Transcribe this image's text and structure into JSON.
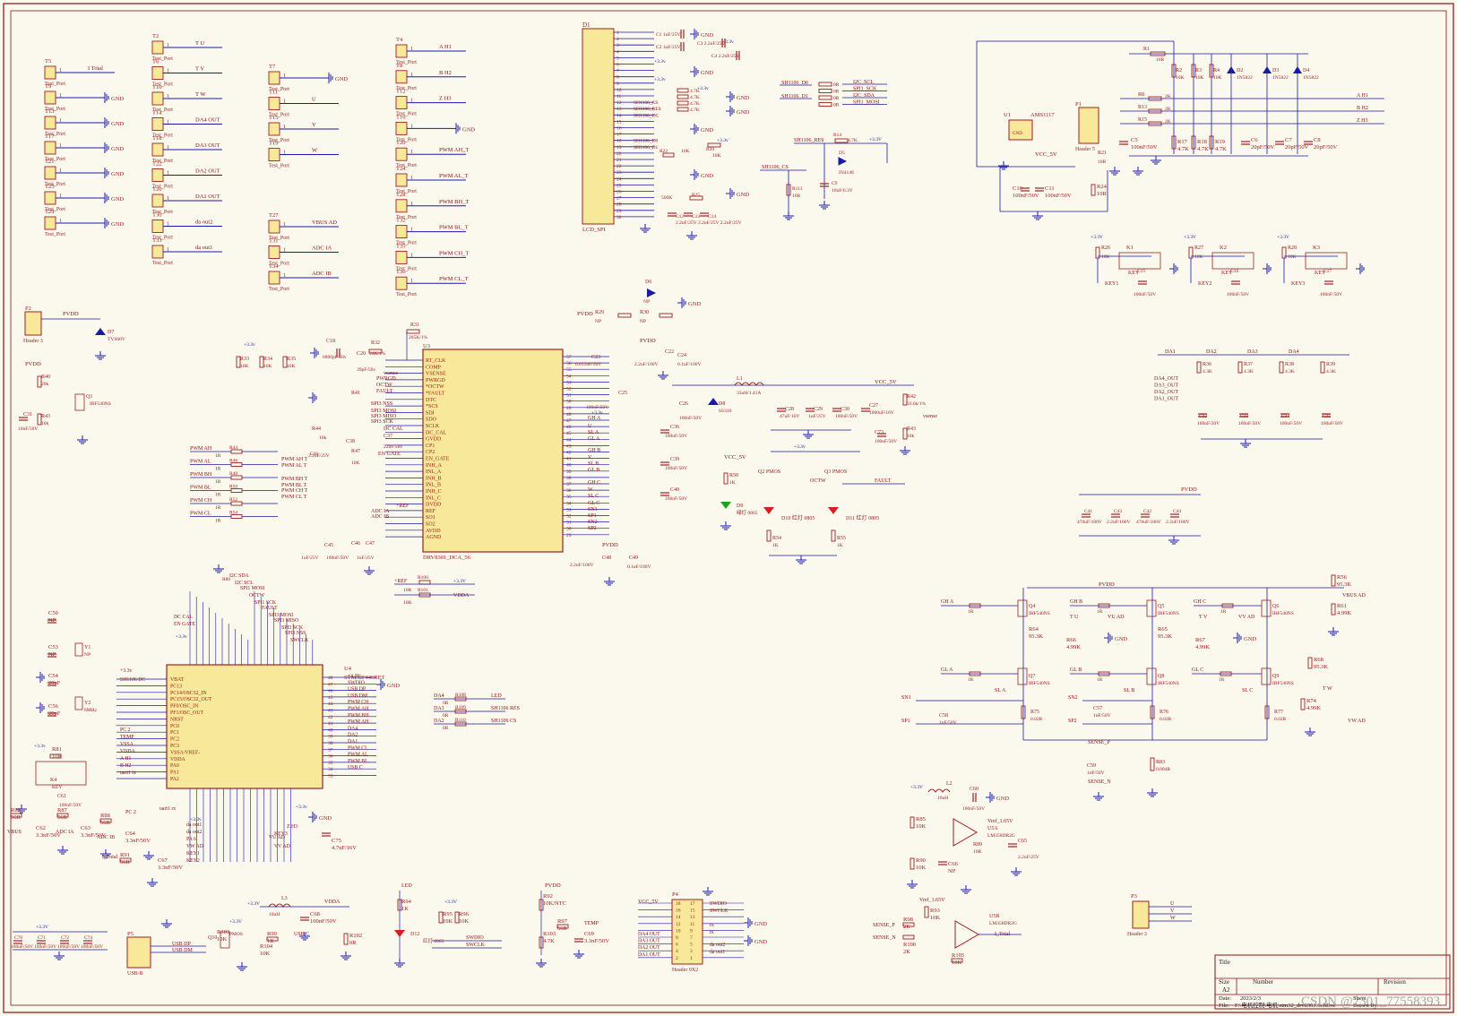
{
  "colors": {
    "paper": "#fbf8ee",
    "wire": "#1a1aa8",
    "part": "#a02020",
    "body": "#f8e89a",
    "netlabel": "#8a1010",
    "power": "#1a1aa8"
  },
  "test_ports": [
    {
      "ref": "T5",
      "net": "I_Total",
      "pin": "1",
      "sub": "Test_Port"
    },
    {
      "ref": "T9",
      "net": "GND",
      "pin": "1",
      "sub": "Test_Port"
    },
    {
      "ref": "T13",
      "net": "GND",
      "pin": "1",
      "sub": "Test_Port"
    },
    {
      "ref": "T17",
      "net": "GND",
      "pin": "1",
      "sub": "Test_Port"
    },
    {
      "ref": "T21",
      "net": "GND",
      "pin": "1",
      "sub": "Test_Port"
    },
    {
      "ref": "T25",
      "net": "GND",
      "pin": "1",
      "sub": "Test_Port"
    },
    {
      "ref": "T29",
      "net": "GND",
      "pin": "1",
      "sub": "Test_Port"
    },
    {
      "ref": "T2",
      "net": "T_U",
      "pin": "1",
      "sub": "Test_Port"
    },
    {
      "ref": "T6",
      "net": "T_V",
      "pin": "1",
      "sub": "Test_Port"
    },
    {
      "ref": "T10",
      "net": "T_W",
      "pin": "1",
      "sub": "Test_Port"
    },
    {
      "ref": "T14",
      "net": "DA4_OUT",
      "pin": "1",
      "sub": "Test_Port"
    },
    {
      "ref": "T18",
      "net": "DA3_OUT",
      "pin": "1",
      "sub": "Test_Port"
    },
    {
      "ref": "T22",
      "net": "DA2_OUT",
      "pin": "1",
      "sub": "Test_Port"
    },
    {
      "ref": "T26",
      "net": "DA1_OUT",
      "pin": "1",
      "sub": "Test_Port"
    },
    {
      "ref": "T30",
      "net": "da_out2",
      "pin": "1",
      "sub": "Test_Port"
    },
    {
      "ref": "T33",
      "net": "da_out1",
      "pin": "1",
      "sub": "Test_Port"
    },
    {
      "ref": "T7",
      "net": "GND",
      "pin": "1",
      "sub": "Test_Port"
    },
    {
      "ref": "T11",
      "net": "U",
      "pin": "1",
      "sub": "Test_Port"
    },
    {
      "ref": "T15",
      "net": "V",
      "pin": "1",
      "sub": "Test_Port"
    },
    {
      "ref": "T19",
      "net": "W",
      "pin": "1",
      "sub": "Test_Port"
    },
    {
      "ref": "T27",
      "net": "VBUS_AD",
      "pin": "1",
      "sub": "Test_Port"
    },
    {
      "ref": "T31",
      "net": "ADC_IA",
      "pin": "1",
      "sub": "Test_Port"
    },
    {
      "ref": "T34",
      "net": "ADC_IB",
      "pin": "1",
      "sub": "Test_Port"
    },
    {
      "ref": "T4",
      "net": "A_H1",
      "pin": "1",
      "sub": "Test_Port"
    },
    {
      "ref": "T8",
      "net": "B_H2",
      "pin": "1",
      "sub": "Test_Port"
    },
    {
      "ref": "T12",
      "net": "Z_H3",
      "pin": "1",
      "sub": "Test_Port"
    },
    {
      "ref": "T16",
      "net": "GND",
      "pin": "1",
      "sub": "Test_Port"
    },
    {
      "ref": "T20",
      "net": "PWM_AH_T",
      "pin": "1",
      "sub": "Test_Port"
    },
    {
      "ref": "T24",
      "net": "PWM_AL_T",
      "pin": "1",
      "sub": "Test_Port"
    },
    {
      "ref": "T28",
      "net": "PWM_BH_T",
      "pin": "1",
      "sub": "Test_Port"
    },
    {
      "ref": "T32",
      "net": "PWM_BL_T",
      "pin": "1",
      "sub": "Test_Port"
    },
    {
      "ref": "T35",
      "net": "PWM_CH_T",
      "pin": "1",
      "sub": "Test_Port"
    },
    {
      "ref": "T36",
      "net": "PWM_CL_T",
      "pin": "1",
      "sub": "Test_Port"
    }
  ],
  "lcd": {
    "ref": "D1",
    "value": "LCD_SPI",
    "pins": [
      "1",
      "2",
      "3",
      "4",
      "5",
      "6",
      "7",
      "8",
      "9",
      "10",
      "11",
      "12",
      "13",
      "14",
      "15",
      "16",
      "17",
      "18",
      "19",
      "20",
      "21",
      "22",
      "23",
      "24",
      "25",
      "26",
      "27",
      "28",
      "29",
      "30"
    ],
    "nets": [
      {
        "pin": "12",
        "name": "SH1106_CS"
      },
      {
        "pin": "13",
        "name": "SH1106_RES"
      },
      {
        "pin": "14",
        "name": "SH1106_DC"
      },
      {
        "pin": "18",
        "name": "SH1106_D0"
      },
      {
        "pin": "19",
        "name": "SH1106_D1"
      }
    ],
    "parts": [
      "C1 1uF/25V",
      "C2 1uF/25V",
      "C3 2.2uF/25V",
      "C4 2.2uF/25V",
      "R5 4.7K",
      "R6 4.7K",
      "R7 4.7K",
      "R8 4.7K",
      "R20 10K",
      "R22 0R",
      "R23 10K",
      "R25 560K",
      "C12 2.2uF/25V",
      "C13 2.2uF/25V",
      "C14 2.2uF/25V"
    ]
  },
  "i2c_block": {
    "rows": [
      {
        "left": "SH1106_D0",
        "res": "0R",
        "right": "I2C_SCL"
      },
      {
        "left": "",
        "res": "0R",
        "right": "SPI1_SCK"
      },
      {
        "left": "SH1106_D1",
        "res": "0R",
        "right": "I2C_SDA"
      },
      {
        "left": "",
        "res": "0R",
        "right": "SPI1_MOSI"
      }
    ],
    "res_refs": [
      "R9",
      "R10",
      "R11",
      "R12"
    ]
  },
  "reset_block": {
    "net": "SH1106_RES",
    "r": "R14 4.7K",
    "supply": "+3.3V",
    "diode": "D5 IN4148",
    "cap": "C9 10uF/6.3V"
  },
  "cs_block": {
    "net": "SH1106_CS",
    "r": "R111 10R"
  },
  "hall_block": {
    "u": "U1",
    "reg": "AMS1117",
    "vcc": "VCC_5V",
    "header": "P1",
    "header_value": "Header 5",
    "outputs": [
      "A_H1",
      "B_H2",
      "Z_H3"
    ],
    "parts": [
      "R1 10R",
      "R2 10K",
      "R3 10K",
      "R4 10K",
      "D2 1N5822",
      "D3 1N5822",
      "D4 1N5822",
      "R8 2K",
      "R13 2K",
      "R15 2K",
      "R17 4.7K",
      "R18 4.7K",
      "R19 4.7K",
      "C6 20pF/50V",
      "C7 20pF/50V",
      "C8 20pF/50V",
      "C5 100nF/50V",
      "R21 10R",
      "R24 10R",
      "C10 100nF/50V",
      "C11 100nF/50V"
    ]
  },
  "keys": [
    {
      "ref": "K1",
      "r": "R26 10K",
      "net": "KEY1",
      "cap": "C15 100nF/50V",
      "supply": "+3.3V"
    },
    {
      "ref": "K2",
      "r": "R27 10K",
      "net": "KEY2",
      "cap": "C16 100nF/50V",
      "supply": "+3.3V"
    },
    {
      "ref": "K3",
      "r": "R28 10K",
      "net": "KEY3",
      "cap": "C17 100nF/50V",
      "supply": "+3.3V"
    }
  ],
  "drv": {
    "ref": "U3",
    "value": "DRV8301_DCA_56",
    "left_pins": [
      "RT_CLK",
      "COMP",
      "VSENSE",
      "PWRGD",
      "*OCTW",
      "*FAULT",
      "DTC",
      "*SCS",
      "SDI",
      "SDO",
      "SCLK",
      "DC_CAL",
      "GVDD",
      "CP1",
      "CP2",
      "EN_GATE",
      "INH_A",
      "INL_A",
      "INH_B",
      "INL_B",
      "INH_C",
      "INL_C",
      "DVDD",
      "REF",
      "SO1",
      "SO2",
      "AVDD",
      "AGND"
    ],
    "right_pins": [
      "57",
      "56",
      "55",
      "54",
      "53",
      "52",
      "51",
      "50",
      "49",
      "48",
      "47",
      "46",
      "45",
      "44",
      "43",
      "42",
      "41",
      "40",
      "39",
      "38",
      "37",
      "36",
      "35",
      "34",
      "33",
      "32",
      "31",
      "30",
      "29"
    ],
    "left_nets": [
      "vsense",
      "PWRGD",
      "OCTW",
      "FAULT",
      "SPI3_NSS",
      "SPI3_MOSI",
      "SPI3_MISO",
      "SPI3_SCK",
      "DC_CAL",
      "EN_GATE",
      "PWM_AH_T",
      "PWM_AL_T",
      "PWM_BH_T",
      "PWM_BL_T",
      "PWM_CH_T",
      "PWM_CL_T",
      "+REF",
      "ADC_IA",
      "ADC_IB"
    ],
    "right_nets": [
      "GH_A",
      "U",
      "SL_A",
      "GL_A",
      "GH_B",
      "V",
      "SL_B",
      "GL_B",
      "GH_C",
      "W",
      "SL_C",
      "GL_C",
      "SN1",
      "SP1",
      "SN2",
      "SP2"
    ],
    "pwm_in": [
      "PWM_AH",
      "PWM_AL",
      "PWM_BH",
      "PWM_BL",
      "PWM_CH",
      "PWM_CL"
    ]
  },
  "buck": {
    "l1": "L1 33uH/1.41A",
    "d8": "D8 SS310",
    "vout": "VCC_5V",
    "r42": "R42 33.6k/1%",
    "r43": "R43 10k",
    "c27": "C27 1000uF/16V",
    "c28": "C28 47uF/16V",
    "c29": "C29 1uF/25V",
    "c30": "C30 100nF/50V",
    "c73": "C73 100nF/50V",
    "net": "vsense"
  },
  "mosfet_leds": {
    "q2": "Q2 PMOS",
    "q3": "Q3 PMOS",
    "d10": "D10 红灯 0805",
    "d11": "D11 红灯 0805",
    "d9": "D9 绿灯 0805",
    "r50": "R50 1K",
    "r54": "R54 1K",
    "r55": "R55 1K",
    "net1": "OCTW",
    "net2": "FAULT",
    "supply": "+3.3v",
    "vcc": "VCC_5V"
  },
  "header3": {
    "ref": "P2",
    "value": "Header 3",
    "pvdd": "PVDD",
    "d7": "D7 TVS60V",
    "q1": "Q1 IRF540NS",
    "r40": "R40 20k",
    "r43": "R43 10k",
    "c31": "C31 10nF/50V"
  },
  "dac_block": {
    "nets": [
      "DA1",
      "DA2",
      "DA3",
      "DA4"
    ],
    "outs": [
      "DA4_OUT",
      "DA3_OUT",
      "DA2_OUT",
      "DA1_OUT"
    ],
    "res": [
      "R36 4.3K",
      "R37 4.3K",
      "R38 4.3K",
      "R39 4.3K"
    ],
    "caps": [
      "C32 100nF/50V",
      "C33 100nF/50V",
      "C34 100nF/50V",
      "C35 100nF/50V"
    ]
  },
  "bulk_caps": {
    "net": "PVDD",
    "caps": [
      "C41 470uF/100V",
      "C43 2.2uF/100V",
      "C42 470uF/100V",
      "C44 2.2uF/100V"
    ]
  },
  "bridge": {
    "net": "PVDD",
    "gates": [
      "GH_A",
      "GL_A",
      "GH_B",
      "GL_B",
      "GH_C",
      "GL_C"
    ],
    "fets": [
      "Q4 IRF540NS",
      "Q7 IRF540NS",
      "Q5 IRF540NS",
      "Q8 IRF540NS",
      "Q6 IRF540NS",
      "Q9 IRF540NS"
    ],
    "sense": [
      "SN1",
      "SP1",
      "SN2",
      "SP2",
      "SL_A",
      "SL_B",
      "SL_C"
    ],
    "outs": [
      "VBUS_AD",
      "VU_AD",
      "VV_AD",
      "VW_AD",
      "T_U",
      "T_V",
      "T_W",
      "SENSE_P",
      "SENSE_N"
    ],
    "parts": [
      "R56 95.3K",
      "R61 4.99K",
      "R64 95.3K",
      "R66 4.99K",
      "R65 95.3K",
      "R67 4.99K",
      "R68 95.3K",
      "R74 4.99K",
      "R75 0.02R",
      "R76 0.02R",
      "R77 0.02R",
      "R83 0.004R",
      "C57 1nF/50V",
      "C58 1nF/50V",
      "C59 1nF/50V"
    ]
  },
  "amp": {
    "u": "U5A",
    "value": "LM358DR2G",
    "vref": "Vref_1.65V",
    "l2": "L2 10uH",
    "c60": "C60 100nF/50V",
    "r85": "R85 10K",
    "r86": "R86 10K",
    "r90": "R90 10K",
    "c65": "C65 2.2uF/25V",
    "c66": "C66 NP",
    "supply": "+3.3V"
  },
  "amp2": {
    "u": "U5B",
    "value": "LM358DR2G",
    "vref": "Vref_1.65V",
    "r93": "R93 10K",
    "r98": "R98 2K",
    "r100": "R100 2K",
    "r105": "R105 10K",
    "inputs": [
      "SENSE_P",
      "SENSE_N"
    ],
    "out": "I_Total"
  },
  "p3": {
    "ref": "P3",
    "value": "Header 3",
    "pins": [
      "U",
      "V",
      "W"
    ]
  },
  "mcu": {
    "ref": "U4",
    "value": "STM32F446RET",
    "left_pins": [
      "VBAT",
      "PC13",
      "PC14/OSC32_IN",
      "PC15/OSC32_OUT",
      "PF0/OSC_IN",
      "PF1/OSC_OUT",
      "NRST",
      "PC0",
      "PC1",
      "PC2",
      "PC3",
      "VSSA/VREF-",
      "VDDA",
      "PA0",
      "PA1",
      "PA2"
    ],
    "right_nums": [
      "48",
      "47",
      "46",
      "45",
      "44",
      "43",
      "42",
      "41",
      "40",
      "39",
      "38",
      "37",
      "36",
      "35",
      "34",
      "33"
    ],
    "right_nets": [
      "+3.3V",
      "SWDIO",
      "USB_DP",
      "USB_DM",
      "PWM_CH",
      "PWM_AH",
      "PWM_BH",
      "PWM_AH",
      "DA4",
      "DA2",
      "DA1",
      "PWM_CL",
      "PWM_AL",
      "PWM_BL",
      "USB_C"
    ],
    "left_nets": [
      "+3.3v",
      "SH1106_DC",
      "PC_2",
      "TEMP",
      "VSSA",
      "VDDA",
      "A_H1",
      "B_H2",
      "uart1_tx"
    ],
    "top_nets": [
      "I2C_SDA",
      "I2C_SCL",
      "SPI1_MOSI",
      "OCTW",
      "SPI1_SCK",
      "FAULT",
      "SPI3_MOSI",
      "SPI3_MISO",
      "SPI3_SCK",
      "SPI3_NSS",
      "SWCLK",
      "DC_CAL",
      "EN_GATE"
    ],
    "bottom_nets": [
      "uart1_rx",
      "da_out1",
      "da_out2",
      "PA_6",
      "VW_AD",
      "KEY1",
      "KEY2",
      "Z_H3",
      "VU_AD",
      "KEY3",
      "VV_AD"
    ],
    "parts": [
      "C50 NP",
      "C53 NP",
      "Y1 NP",
      "C54 20pF",
      "C56 20pF",
      "Y2 8MHz",
      "R81 10K",
      "K4 KEY",
      "C61 100nF/50V",
      "R86 56R",
      "R87 56R",
      "R88 56R",
      "C62 3.3nF/50V",
      "C63 3.3nF/50V",
      "C64 3.3nF/50V",
      "R91 56R",
      "C67 3.3nF/50V",
      "C75 4.7uF/16V"
    ]
  },
  "mcu_side": {
    "rows": [
      {
        "left": "DA4",
        "r": "R108 0R",
        "right": "LED"
      },
      {
        "left": "DA3",
        "r": "R109 0R",
        "right": "SH1106_RES"
      },
      {
        "left": "DA2",
        "r": "R110 0R",
        "right": "SH1106_CS"
      }
    ]
  },
  "ref_block": {
    "net": "+REF",
    "r1": "R100 10R",
    "r2": "R101 10R",
    "supply": "+3.3V",
    "vdda": "VDDA"
  },
  "bottom": {
    "caps_row": [
      "C70 100nF/50V",
      "C71 100nF/50V",
      "C72 100nF/50V",
      "C74 100nF/50V"
    ],
    "usb": {
      "ref": "P5",
      "value": "USB-B",
      "nets": [
        "USB_DP",
        "USB_DM",
        "USB_C"
      ],
      "q10": "Q10 PMOS",
      "r99": "R99 1K",
      "r102": "R102 0R",
      "r103": "R103 10K",
      "r104": "R104 10K"
    },
    "l3": {
      "ref": "L3 10uH",
      "supply": "+3.3V",
      "out": "VDDA",
      "cap": "C68 100nF/50V"
    },
    "led": {
      "net": "LED",
      "r": "R94 1K",
      "d": "D12 红灯 0805"
    },
    "swd": {
      "r95": "R95 10K",
      "r96": "R96 10K",
      "supply": "+3.3V",
      "nets": [
        "SWDIO",
        "SWCLK"
      ]
    },
    "ntc": {
      "pvdd": "PVDD",
      "r92": "R92 10K/NTC",
      "r97": "R97 56R",
      "r103": "R103 4.7K",
      "c69": "C69 3.3nF/50V",
      "net": "TEMP"
    },
    "header": {
      "ref": "P4",
      "value": "Header 9X2",
      "pins": [
        "18",
        "17",
        "16",
        "15",
        "14",
        "13",
        "12",
        "11",
        "10",
        "9",
        "8",
        "7",
        "6",
        "5",
        "4",
        "3",
        "2",
        "1"
      ],
      "nets": [
        "VCC_5V",
        "SWDIO",
        "SWCLK",
        "rx",
        "tx",
        "DA4_OUT",
        "DA3_OUT",
        "DA2_OUT",
        "DA1_OUT",
        "da_out2",
        "da_out1"
      ]
    }
  },
  "title_block": {
    "title": "Title",
    "size_label": "Size",
    "size": "A2",
    "number_label": "Number",
    "revision_label": "Revision",
    "date_label": "Date:",
    "date": "2023/2/3",
    "sheet_label": "Sheet",
    "file_label": "File:",
    "file": "F:\\电机控制\\电机\\stm32_drv8301.SchDoc",
    "drawn_label": "Drawn By:",
    "watermark": "CSDN @2301_77558393"
  },
  "gnd_label": "GND",
  "supply_3v3": "+3.3V"
}
